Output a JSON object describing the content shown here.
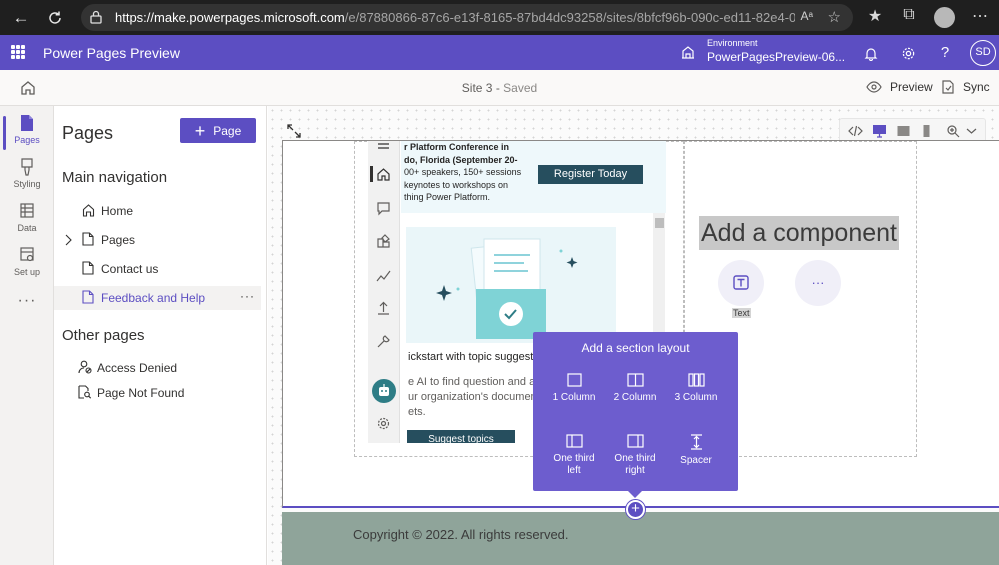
{
  "browser": {
    "url_host": "https://make.powerpages.microsoft.com",
    "url_path": "/e/87880866-87c6-e13f-8165-87bd4dc93258/sites/8bfcf96b-090c-ed11-82e4-000d3adb21ea#we...",
    "reader_label": "Aᵃ"
  },
  "header": {
    "app_title": "Power Pages Preview",
    "environment_label": "Environment",
    "environment_value": "PowerPagesPreview-06...",
    "avatar_initials": "SD",
    "accent_color": "#5c4ec2"
  },
  "command_bar": {
    "site_name": "Site 3",
    "separator": " - ",
    "save_state": "Saved",
    "preview_label": "Preview",
    "sync_label": "Sync"
  },
  "rail": {
    "items": [
      {
        "label": "Pages",
        "icon": "pages-icon"
      },
      {
        "label": "Styling",
        "icon": "styling-icon"
      },
      {
        "label": "Data",
        "icon": "data-icon"
      },
      {
        "label": "Set up",
        "icon": "setup-icon"
      }
    ],
    "more": "···"
  },
  "pages_panel": {
    "title": "Pages",
    "add_button": "Page",
    "main_nav_heading": "Main navigation",
    "main_nav_items": [
      {
        "label": "Home",
        "icon": "home-icon"
      },
      {
        "label": "Pages",
        "icon": "page-icon"
      },
      {
        "label": "Contact us",
        "icon": "page-icon"
      },
      {
        "label": "Feedback and Help",
        "icon": "page-icon"
      }
    ],
    "other_heading": "Other pages",
    "other_items": [
      {
        "label": "Access Denied",
        "icon": "user-blocked-icon"
      },
      {
        "label": "Page Not Found",
        "icon": "page-search-icon"
      }
    ],
    "row_more": "···"
  },
  "preview": {
    "banner_lines": [
      "r Platform Conference in",
      "do, Florida (September 20-",
      "00+ speakers, 150+ sessions",
      "keynotes to workshops on",
      "thing Power Platform."
    ],
    "register_label": "Register Today",
    "quickstart_title": "ickstart with topic suggesti",
    "quickstart_desc": [
      "e AI to find question and a",
      "ur organization's documen",
      "ets."
    ],
    "suggest_label": "Suggest topics"
  },
  "canvas": {
    "add_component": "Add a component",
    "text_component_label": "Text",
    "more_components": "···",
    "footer_text": "Copyright © 2022. All rights reserved.",
    "footer_color": "#8fa49a",
    "add_section_plus": "+"
  },
  "section_popup": {
    "title": "Add a section layout",
    "options": [
      {
        "line1": "1 Column",
        "line2": "",
        "icon": "one-column-icon"
      },
      {
        "line1": "2 Column",
        "line2": "",
        "icon": "two-column-icon"
      },
      {
        "line1": "3 Column",
        "line2": "",
        "icon": "three-column-icon"
      },
      {
        "line1": "One third",
        "line2": "left",
        "icon": "one-third-left-icon"
      },
      {
        "line1": "One third",
        "line2": "right",
        "icon": "one-third-right-icon"
      },
      {
        "line1": "Spacer",
        "line2": "",
        "icon": "spacer-icon"
      }
    ]
  }
}
